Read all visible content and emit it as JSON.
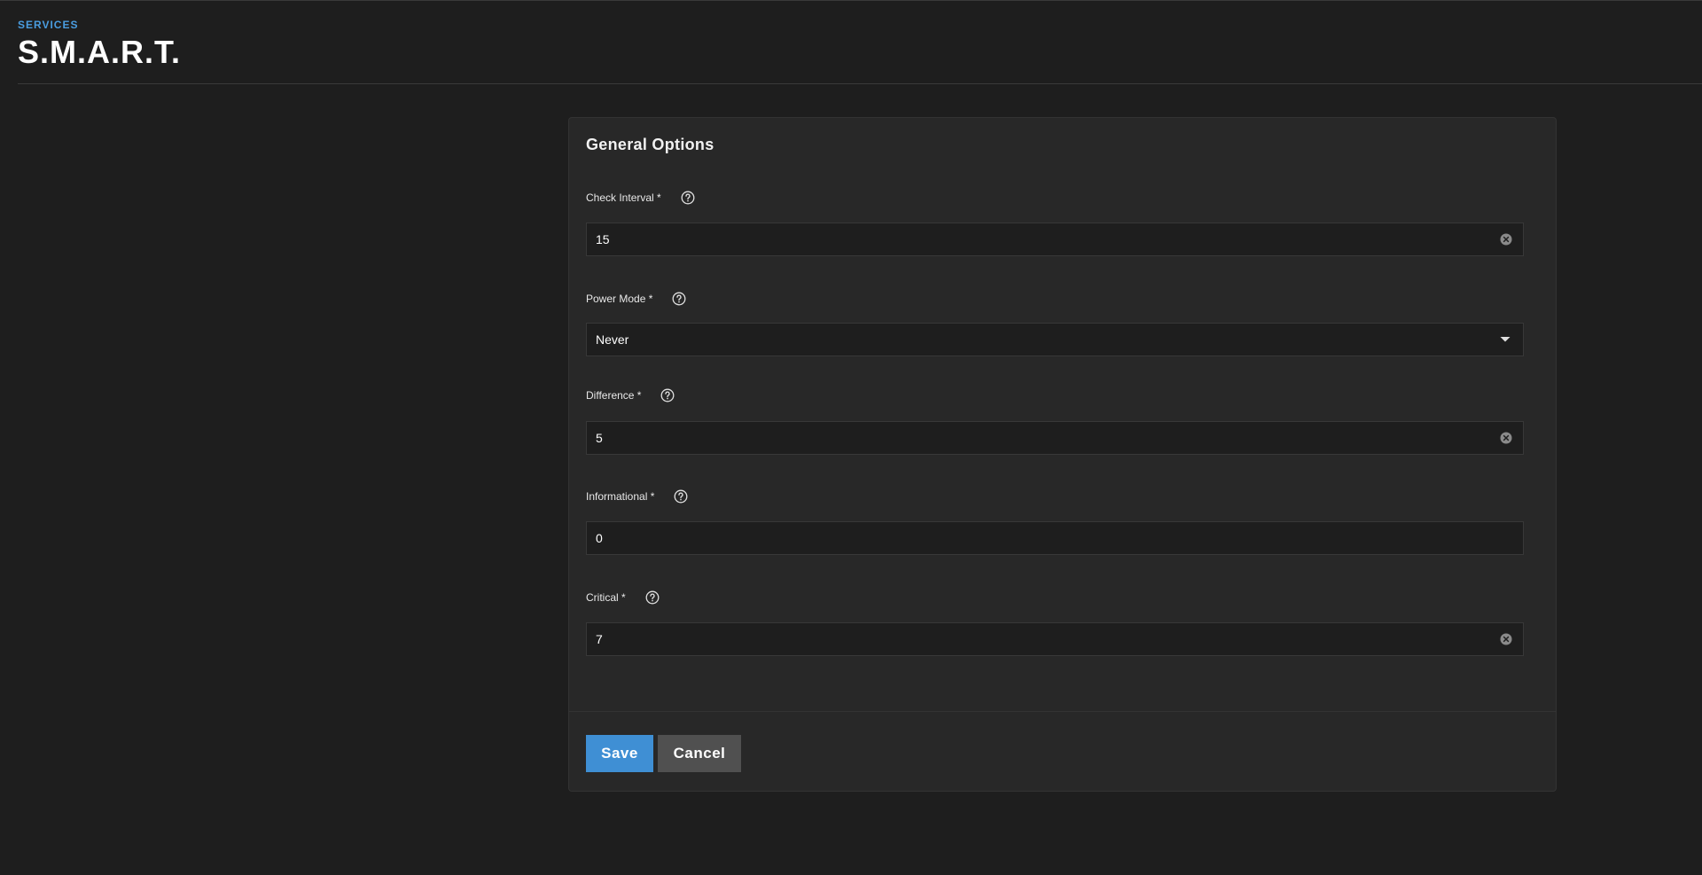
{
  "header": {
    "breadcrumb": "SERVICES",
    "title": "S.M.A.R.T."
  },
  "form": {
    "title": "General Options",
    "fields": [
      {
        "label": "Check Interval *",
        "value": "15",
        "type": "input",
        "clearable": true
      },
      {
        "label": "Power Mode *",
        "value": "Never",
        "type": "select",
        "clearable": false
      },
      {
        "label": "Difference *",
        "value": "5",
        "type": "input",
        "clearable": true
      },
      {
        "label": "Informational *",
        "value": "0",
        "type": "input",
        "clearable": false
      },
      {
        "label": "Critical *",
        "value": "7",
        "type": "input",
        "clearable": true
      }
    ],
    "save_label": "Save",
    "cancel_label": "Cancel"
  },
  "icons": {
    "help": "help-circle-icon",
    "clear": "close-circle-icon",
    "dropdown": "caret-down-icon"
  },
  "colors": {
    "background": "#1e1e1e",
    "card": "#282828",
    "accent": "#3f8fd4",
    "breadcrumb": "#4a9de0",
    "cancel": "#505050"
  }
}
